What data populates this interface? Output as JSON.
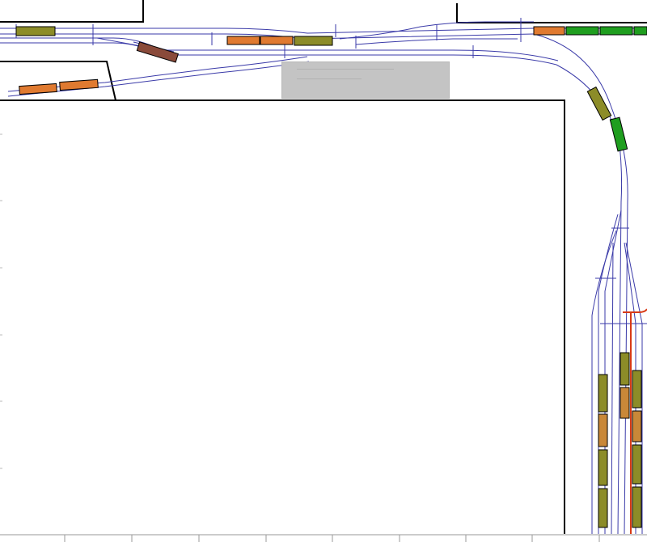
{
  "diagram": {
    "kind": "model railroad track plan",
    "colors": {
      "track": "#3a3aa8",
      "benchwork": "#000000",
      "grid": "#9a9a9a",
      "olive_car": "#8c8c28",
      "green_car": "#1f9e1f",
      "orange_car": "#e07a30",
      "tank_car": "#c98838",
      "brown_car": "#8a4a3a",
      "bumper": "#d83a16",
      "label_panel": "#c4c4c4"
    },
    "rolling_stock": [
      {
        "id": "car-olive-top-left",
        "kind": "olive-boxcar",
        "color": "olive_car"
      },
      {
        "id": "car-brown-spur",
        "kind": "brown-boxcar",
        "color": "brown_car"
      },
      {
        "id": "car-orange-center-1",
        "kind": "orange-flatcar",
        "color": "orange_car"
      },
      {
        "id": "car-orange-center-2",
        "kind": "orange-flatcar",
        "color": "orange_car"
      },
      {
        "id": "car-olive-center",
        "kind": "olive-boxcar",
        "color": "olive_car"
      },
      {
        "id": "car-orange-lower-1",
        "kind": "orange-flatcar",
        "color": "orange_car"
      },
      {
        "id": "car-orange-lower-2",
        "kind": "orange-flatcar",
        "color": "orange_car"
      },
      {
        "id": "car-orange-top-right",
        "kind": "orange-hopper",
        "color": "orange_car"
      },
      {
        "id": "car-green-1",
        "kind": "green-hopper",
        "color": "green_car"
      },
      {
        "id": "car-green-2",
        "kind": "green-hopper",
        "color": "green_car"
      },
      {
        "id": "car-green-3",
        "kind": "green-hopper",
        "color": "green_car"
      },
      {
        "id": "car-olive-curve",
        "kind": "olive-boxcar",
        "color": "olive_car"
      },
      {
        "id": "car-green-curve",
        "kind": "green-boxcar",
        "color": "green_car"
      },
      {
        "id": "car-yard-a-1",
        "kind": "olive-boxcar",
        "color": "olive_car"
      },
      {
        "id": "car-yard-a-2",
        "kind": "tank-car",
        "color": "tank_car"
      },
      {
        "id": "car-yard-a-3",
        "kind": "olive-boxcar",
        "color": "olive_car"
      },
      {
        "id": "car-yard-a-4",
        "kind": "olive-boxcar",
        "color": "olive_car"
      },
      {
        "id": "car-yard-b-1",
        "kind": "olive-boxcar",
        "color": "olive_car"
      },
      {
        "id": "car-yard-b-2",
        "kind": "tank-car",
        "color": "tank_car"
      },
      {
        "id": "car-yard-c-1",
        "kind": "olive-boxcar",
        "color": "olive_car"
      },
      {
        "id": "car-yard-c-2",
        "kind": "tank-car",
        "color": "tank_car"
      },
      {
        "id": "car-yard-c-3",
        "kind": "olive-boxcar",
        "color": "olive_car"
      },
      {
        "id": "car-yard-c-4",
        "kind": "olive-boxcar",
        "color": "olive_car"
      }
    ]
  }
}
